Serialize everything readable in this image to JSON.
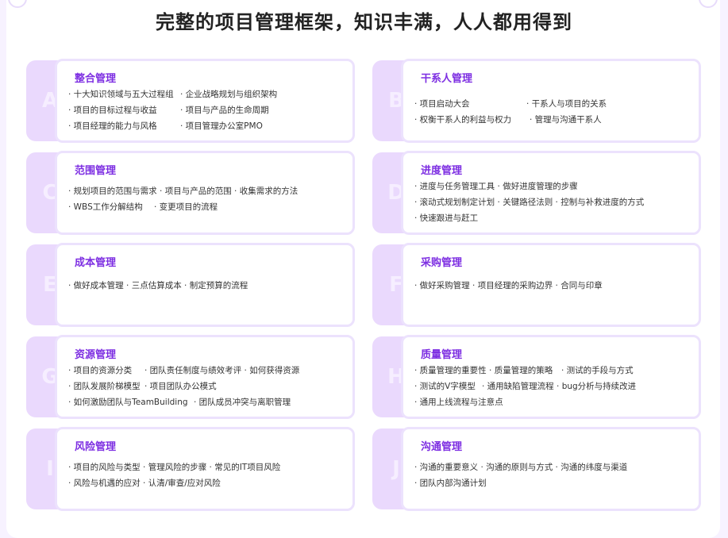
{
  "title": "完整的项目管理框架，知识丰满，人人都用得到",
  "cards": [
    {
      "letter": "A",
      "title": "整合管理",
      "lines": [
        [
          "· 十大知识领域与五大过程组",
          "· 企业战略规划与组织架构"
        ],
        [
          "· 项目的目标过程与收益",
          "· 项目与产品的生命周期"
        ],
        [
          "· 项目经理的能力与风格",
          "· 项目管理办公室PMO"
        ]
      ]
    },
    {
      "letter": "B",
      "title": "干系人管理",
      "lines": [
        [
          "· 项目启动大会",
          "· 干系人与项目的关系"
        ],
        [
          "· 权衡干系人的利益与权力",
          "· 管理与沟通干系人"
        ]
      ]
    },
    {
      "letter": "C",
      "title": "范围管理",
      "lines": [
        [
          "· 规划项目的范围与需求 · 项目与产品的范围 · 收集需求的方法"
        ],
        [
          "· WBS工作分解结构",
          "· 变更项目的流程"
        ]
      ]
    },
    {
      "letter": "D",
      "title": "进度管理",
      "lines": [
        [
          "· 进度与任务管理工具 · 做好进度管理的步骤"
        ],
        [
          "· 滚动式规划制定计划 · 关键路径法则 · 控制与补救进度的方式"
        ],
        [
          "· 快速跟进与赶工"
        ]
      ]
    },
    {
      "letter": "E",
      "title": "成本管理",
      "lines": [
        [
          "· 做好成本管理 · 三点估算成本 · 制定预算的流程"
        ]
      ]
    },
    {
      "letter": "F",
      "title": "采购管理",
      "lines": [
        [
          "· 做好采购管理 · 项目经理的采购边界 · 合同与印章"
        ]
      ]
    },
    {
      "letter": "G",
      "title": "资源管理",
      "lines": [
        [
          "· 项目的资源分类",
          "· 团队责任制度与绩效考评 · 如何获得资源"
        ],
        [
          "· 团队发展阶梯模型",
          "· 项目团队办公模式"
        ],
        [
          "· 如何激励团队与TeamBuilding",
          "· 团队成员冲突与离职管理"
        ]
      ]
    },
    {
      "letter": "H",
      "title": "质量管理",
      "lines": [
        [
          "· 质量管理的重要性 · 质量管理的策略",
          "· 测试的手段与方式"
        ],
        [
          "· 测试的V字模型",
          "· 通用缺陷管理流程 · bug分析与持续改进"
        ],
        [
          "· 通用上线流程与注意点"
        ]
      ]
    },
    {
      "letter": "I",
      "title": "风险管理",
      "lines": [
        [
          "· 项目的风险与类型 · 管理风险的步骤 · 常见的IT项目风险"
        ],
        [
          "· 风险与机遇的应对 · 认清/审查/应对风险"
        ]
      ]
    },
    {
      "letter": "J",
      "title": "沟通管理",
      "lines": [
        [
          "· 沟通的重要意义 · 沟通的原则与方式 · 沟通的纬度与渠道"
        ],
        [
          "· 团队内部沟通计划"
        ]
      ]
    }
  ]
}
